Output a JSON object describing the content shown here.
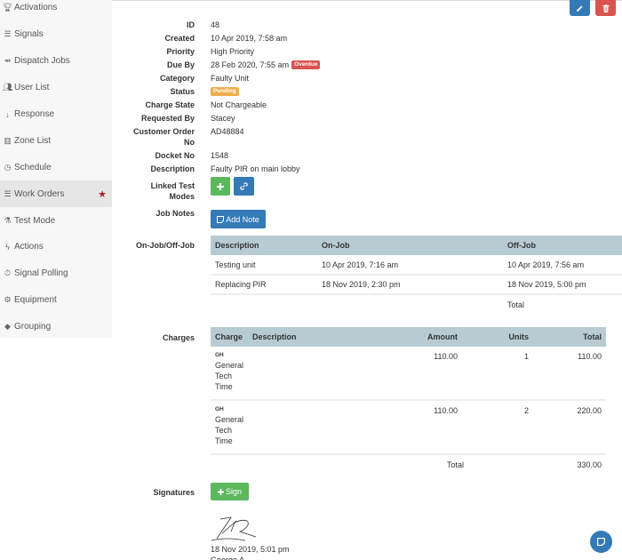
{
  "sidebar": {
    "items": [
      {
        "label": "Activations",
        "icon": "trophy-icon"
      },
      {
        "label": "Signals",
        "icon": "list-icon"
      },
      {
        "label": "Dispatch Jobs",
        "icon": "car-icon"
      },
      {
        "label": "User List",
        "icon": "users-icon"
      },
      {
        "label": "Response",
        "icon": "sort-numeric-icon"
      },
      {
        "label": "Zone List",
        "icon": "building-icon"
      },
      {
        "label": "Schedule",
        "icon": "clock-icon"
      },
      {
        "label": "Work Orders",
        "icon": "list-ol-icon",
        "active": true,
        "starred": true
      },
      {
        "label": "Test Mode",
        "icon": "flask-icon"
      },
      {
        "label": "Actions",
        "icon": "bolt-icon"
      },
      {
        "label": "Signal Polling",
        "icon": "stopwatch-icon"
      },
      {
        "label": "Equipment",
        "icon": "cog-icon"
      },
      {
        "label": "Grouping",
        "icon": "tag-icon"
      }
    ]
  },
  "details": {
    "id": {
      "label": "ID",
      "value": "48"
    },
    "created": {
      "label": "Created",
      "value": "10 Apr 2019, 7:58 am"
    },
    "priority": {
      "label": "Priority",
      "value": "High Priority"
    },
    "due_by": {
      "label": "Due By",
      "value": "28 Feb 2020, 7:55 am",
      "badge": "Overdue"
    },
    "category": {
      "label": "Category",
      "value": "Faulty Unit"
    },
    "status": {
      "label": "Status",
      "badge": "Pending"
    },
    "charge_state": {
      "label": "Charge State",
      "value": "Not Chargeable"
    },
    "requested_by": {
      "label": "Requested By",
      "value": "Stacey"
    },
    "customer_order": {
      "label_1": "Customer Order",
      "label_2": "No",
      "value": "AD48884"
    },
    "docket_no": {
      "label": "Docket No",
      "value": "1548"
    },
    "description": {
      "label": "Description",
      "value": "Faulty PIR on main lobby"
    },
    "linked_test_modes": {
      "label_1": "Linked Test",
      "label_2": "Modes"
    },
    "job_notes": {
      "label": "Job Notes",
      "button": "Add Note"
    }
  },
  "onjob": {
    "label": "On-Job/Off-Job",
    "headers": [
      "Description",
      "On-Job",
      "Off-Job"
    ],
    "rows": [
      {
        "description": "Testing unit",
        "on": "10 Apr 2019, 7:16 am",
        "off": "10 Apr 2019, 7:56 am"
      },
      {
        "description": "Replacing PIR",
        "on": "18 Nov 2019, 2:30 pm",
        "off": "18 Nov 2019, 5:00 pm"
      }
    ],
    "total_label": "Total"
  },
  "charges": {
    "label": "Charges",
    "headers": [
      "Charge",
      "Description",
      "Amount",
      "Units",
      "Total"
    ],
    "rows": [
      {
        "code": "GH",
        "name": [
          "General",
          "Tech",
          "Time"
        ],
        "amount": "110.00",
        "units": "1",
        "total": "110.00"
      },
      {
        "code": "GH",
        "name": [
          "General",
          "Tech",
          "Time"
        ],
        "amount": "110.00",
        "units": "2",
        "total": "220.00"
      }
    ],
    "total_label": "Total",
    "total_value": "330.00"
  },
  "signatures": {
    "label": "Signatures",
    "button": "Sign",
    "entries": [
      {
        "date": "18 Nov 2019, 5:01 pm",
        "name": "George A"
      }
    ]
  },
  "colors": {
    "primary": "#337ab7",
    "success": "#5cb85c",
    "danger": "#d9534f",
    "warning": "#f0ad4e",
    "table_header": "#b8cbd3",
    "star": "#b52626"
  }
}
